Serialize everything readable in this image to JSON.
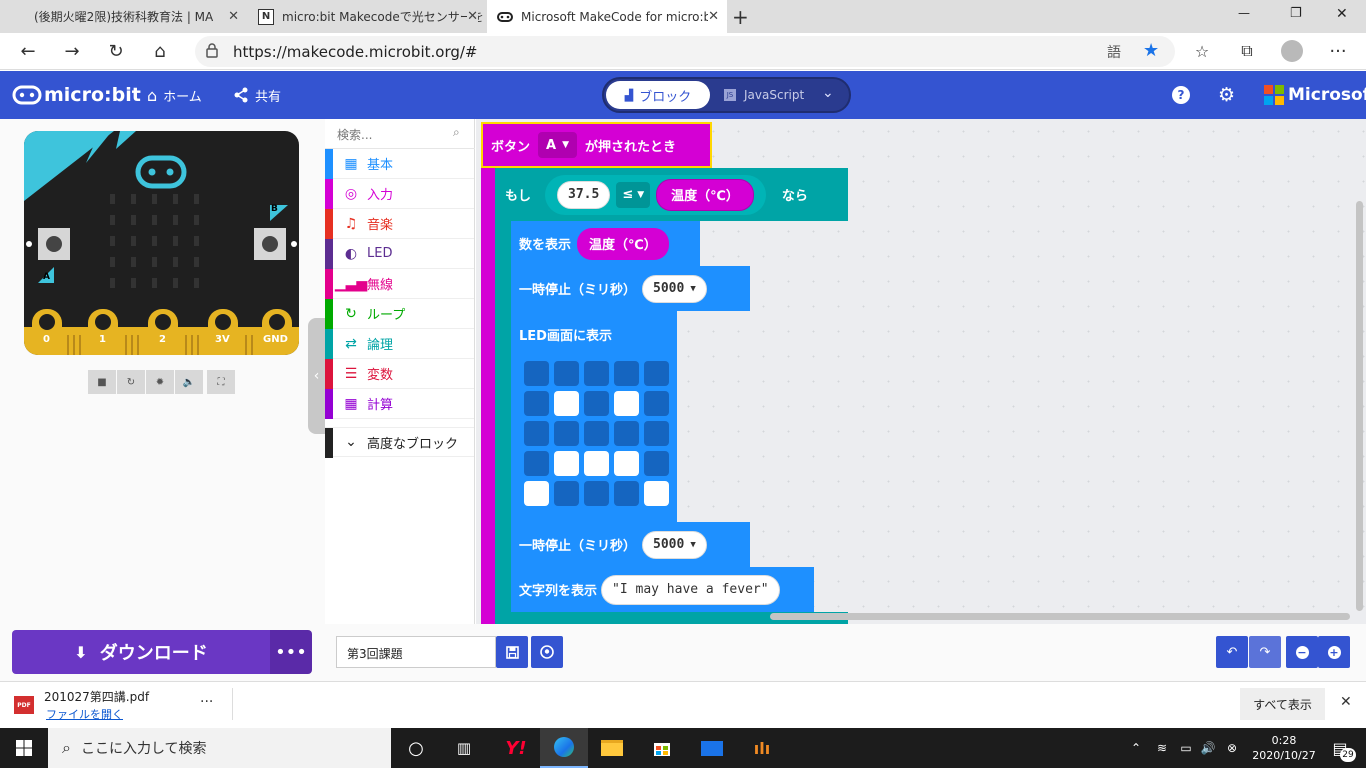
{
  "browser": {
    "tabs": [
      {
        "title": "(後期火曜2限)技術科教育法 | MA"
      },
      {
        "title": "micro:bit Makecodeで光センサーを"
      },
      {
        "title": "Microsoft MakeCode for micro:b"
      }
    ],
    "new_tab": "+",
    "url": "https://makecode.microbit.org/#",
    "window_controls": {
      "minimize": "—",
      "maximize": "❐",
      "close": "✕"
    }
  },
  "header": {
    "logo": "micro:bit",
    "home": "ホーム",
    "share": "共有",
    "tab_blocks": "ブロック",
    "tab_js": "JavaScript",
    "microsoft": "Microsoft"
  },
  "simulator": {
    "pins": [
      "0",
      "1",
      "2",
      "3V",
      "GND"
    ],
    "button_a": "A",
    "button_b": "B"
  },
  "toolbox": {
    "search_placeholder": "検索...",
    "categories": [
      {
        "label": "基本",
        "color": "#1e90ff",
        "icon": "grid-icon"
      },
      {
        "label": "入力",
        "color": "#d400d4",
        "icon": "target-icon"
      },
      {
        "label": "音楽",
        "color": "#e63022",
        "icon": "headphones-icon"
      },
      {
        "label": "LED",
        "color": "#5c2d91",
        "icon": "toggle-icon"
      },
      {
        "label": "無線",
        "color": "#e3008c",
        "icon": "signal-icon"
      },
      {
        "label": "ループ",
        "color": "#00aa00",
        "icon": "refresh-icon"
      },
      {
        "label": "論理",
        "color": "#00a4a6",
        "icon": "shuffle-icon"
      },
      {
        "label": "変数",
        "color": "#dc143c",
        "icon": "list-icon"
      },
      {
        "label": "計算",
        "color": "#9400d3",
        "icon": "calculator-icon"
      }
    ],
    "advanced": "高度なブロック"
  },
  "workspace": {
    "event_block": {
      "text": "ボタン",
      "button": "A",
      "suffix": "が押されたとき"
    },
    "if_block": {
      "if": "もし",
      "value": "37.5",
      "operator": "≤",
      "sensor": "温度（℃）",
      "then": "なら"
    },
    "show_number": {
      "text": "数を表示",
      "sensor": "温度（℃）"
    },
    "pause1": {
      "text": "一時停止（ミリ秒）",
      "value": "5000"
    },
    "show_leds": {
      "text": "LED画面に表示"
    },
    "led_pattern": [
      [
        0,
        0,
        0,
        0,
        0
      ],
      [
        0,
        1,
        0,
        1,
        0
      ],
      [
        0,
        0,
        0,
        0,
        0
      ],
      [
        0,
        1,
        1,
        1,
        0
      ],
      [
        1,
        0,
        0,
        0,
        1
      ]
    ],
    "pause2": {
      "text": "一時停止（ミリ秒）",
      "value": "5000"
    },
    "show_string": {
      "text": "文字列を表示",
      "value": "\"I may have a fever\""
    }
  },
  "bottom": {
    "download": "ダウンロード",
    "more": "•••",
    "project_name": "第3回課題"
  },
  "download_shelf": {
    "file": "201027第四講.pdf",
    "open": "ファイルを開く",
    "file_icon_label": "PDF",
    "more": "···",
    "show_all": "すべて表示",
    "close": "✕"
  },
  "taskbar": {
    "search_placeholder": "ここに入力して検索",
    "time": "0:28",
    "date": "2020/10/27",
    "notification_count": "29"
  }
}
